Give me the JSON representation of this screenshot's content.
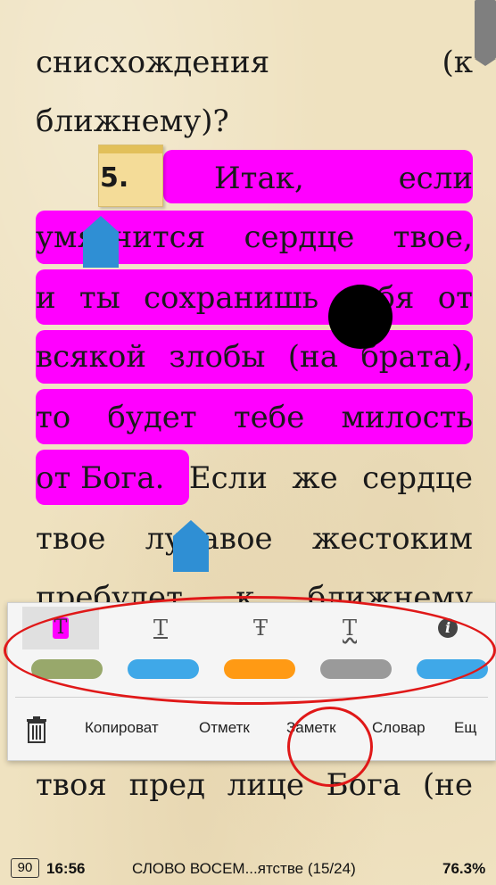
{
  "book": {
    "lines": [
      {
        "words": [
          "снисхождения",
          "(к"
        ]
      },
      {
        "words": [
          "ближнему)?"
        ]
      },
      {
        "words": [
          "5.",
          "Итак,",
          "если"
        ]
      },
      {
        "words": [
          "умягчится",
          "сердце",
          "твое,"
        ]
      },
      {
        "words": [
          "и",
          "ты",
          "сохранишь",
          "себя",
          "от"
        ]
      },
      {
        "words": [
          "всякой",
          "злобы",
          "(на",
          "брата),"
        ]
      },
      {
        "words": [
          "то",
          "будет",
          "тебе",
          "милость"
        ]
      },
      {
        "words": [
          "от Бога.",
          "Если",
          "же",
          "сердце"
        ]
      },
      {
        "words": [
          "твое",
          "лукавое",
          "жестоким"
        ]
      },
      {
        "words": [
          "пребудет",
          "к",
          "ближнему"
        ]
      },
      {
        "words": [
          "твоя",
          "пред",
          "лице",
          "Бога",
          "(не"
        ]
      }
    ]
  },
  "highlight_color": "#ff00ff",
  "menu": {
    "style_buttons": [
      {
        "name": "style-highlight",
        "glyph": "T"
      },
      {
        "name": "style-underline",
        "glyph": "T"
      },
      {
        "name": "style-strikethrough",
        "glyph": "Ŧ"
      },
      {
        "name": "style-wavy-underline",
        "glyph": "T"
      },
      {
        "name": "info",
        "glyph": "i"
      }
    ],
    "colors": [
      "#98a86b",
      "#3fa8e8",
      "#ff9a14",
      "#9a9a9a",
      "#3fa8e8"
    ],
    "actions": {
      "copy": "Копироват",
      "mark": "Отметк",
      "note": "Заметк",
      "dictionary": "Словар",
      "more": "Ещ"
    }
  },
  "status": {
    "battery": "90",
    "time": "16:56",
    "title": "СЛОВО ВОСЕМ...ятстве (15/24)",
    "progress": "76.3%"
  }
}
